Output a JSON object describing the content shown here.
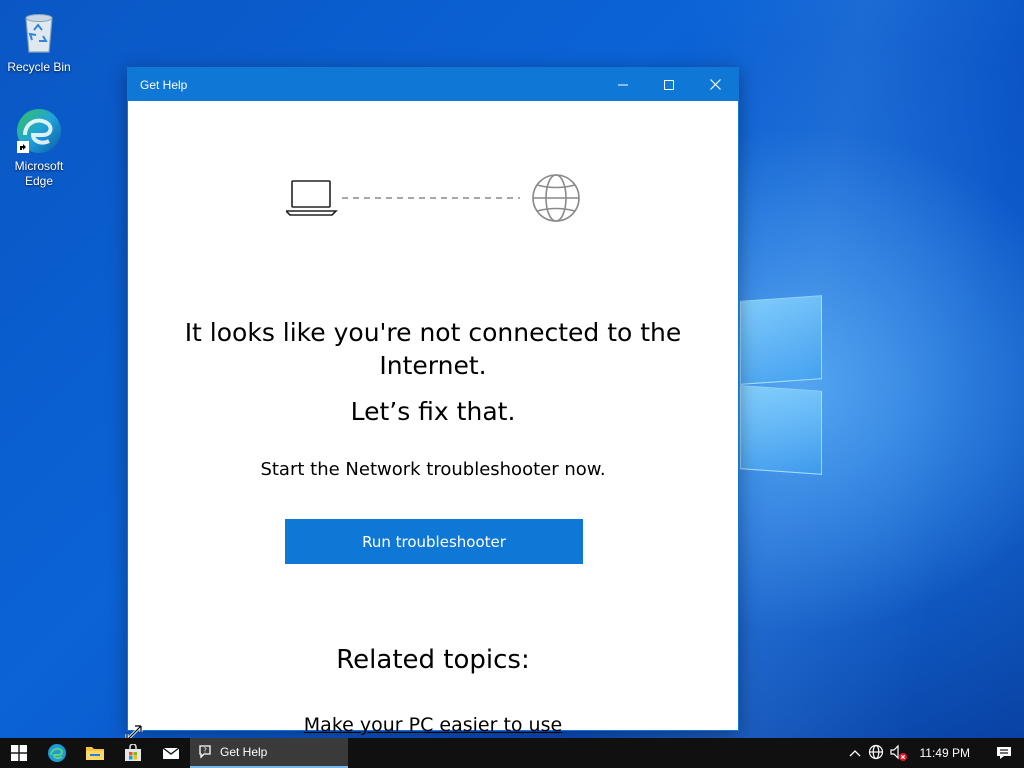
{
  "desktop": {
    "icons": [
      {
        "label": "Recycle Bin"
      },
      {
        "label_line1": "Microsoft",
        "label_line2": "Edge"
      }
    ]
  },
  "window": {
    "title": "Get Help",
    "headline": "It looks like you're not connected to the Internet.",
    "subhead": "Let’s fix that.",
    "description": "Start the Network troubleshooter now.",
    "primary_button": "Run troubleshooter",
    "related_heading": "Related topics:",
    "related_link": "Make your PC easier to use"
  },
  "taskbar": {
    "active_app": "Get Help",
    "clock": "11:49 PM"
  },
  "colors": {
    "accent": "#0f78d7",
    "taskbar": "#101010"
  }
}
